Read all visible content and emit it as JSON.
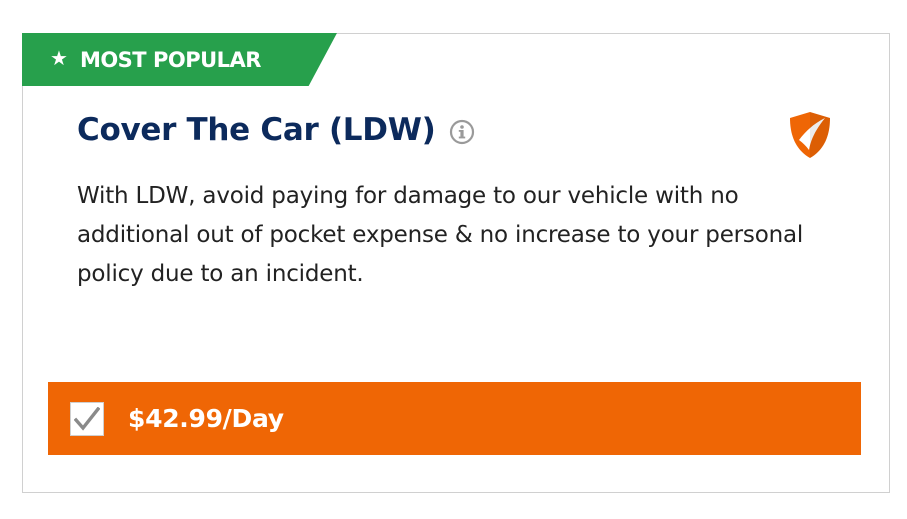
{
  "ribbon": {
    "label": "MOST POPULAR",
    "icon": "star-icon",
    "color": "#27a04c"
  },
  "product": {
    "title": "Cover The Car (LDW)",
    "info_icon": "info-icon",
    "badge_icon": "shield-icon",
    "description": "With LDW, avoid paying for damage to our vehicle with no additional out of pocket expense & no increase to your personal policy due to an incident."
  },
  "selection": {
    "checked": true,
    "price_label": "$42.99/Day",
    "accent_color": "#ef6605"
  },
  "colors": {
    "title": "#0c2a5c",
    "shield": "#ef6605"
  }
}
